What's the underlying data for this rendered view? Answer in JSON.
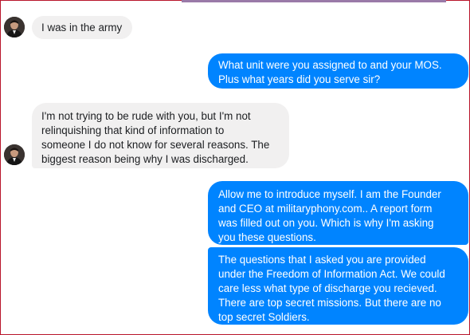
{
  "colors": {
    "incoming_bg": "#f1f0f0",
    "outgoing_bg": "#0084ff",
    "outgoing_text": "#ffffff",
    "incoming_text": "#1c1e21",
    "frame_border": "#b9152b"
  },
  "conversation": {
    "messages": [
      {
        "sender": "contact",
        "avatar_icon": "profile-photo-icon",
        "lines": [
          "I was in the army"
        ]
      },
      {
        "sender": "me",
        "lines": [
          "What unit were you assigned to and your MOS.",
          "Plus what years did you serve sir?"
        ]
      },
      {
        "sender": "contact",
        "avatar_icon": "profile-photo-icon",
        "lines": [
          "I'm not trying to be rude with you, but I'm not",
          "relinquishing that kind of information to",
          "someone I do not know for several reasons. The",
          "biggest reason being why I was discharged."
        ]
      },
      {
        "sender": "me",
        "lines": [
          "Allow me to introduce myself. I am the Founder",
          "and CEO at militaryphony.com.. A report form",
          "was filled out on you. Which is why I'm asking",
          "you these questions."
        ]
      },
      {
        "sender": "me",
        "lines": [
          "The questions that I asked you are provided",
          "under the Freedom of Information Act. We could",
          "care less what type of discharge you recieved.",
          "There are top secret missions. But there are no",
          "top secret Soldiers."
        ]
      }
    ]
  }
}
